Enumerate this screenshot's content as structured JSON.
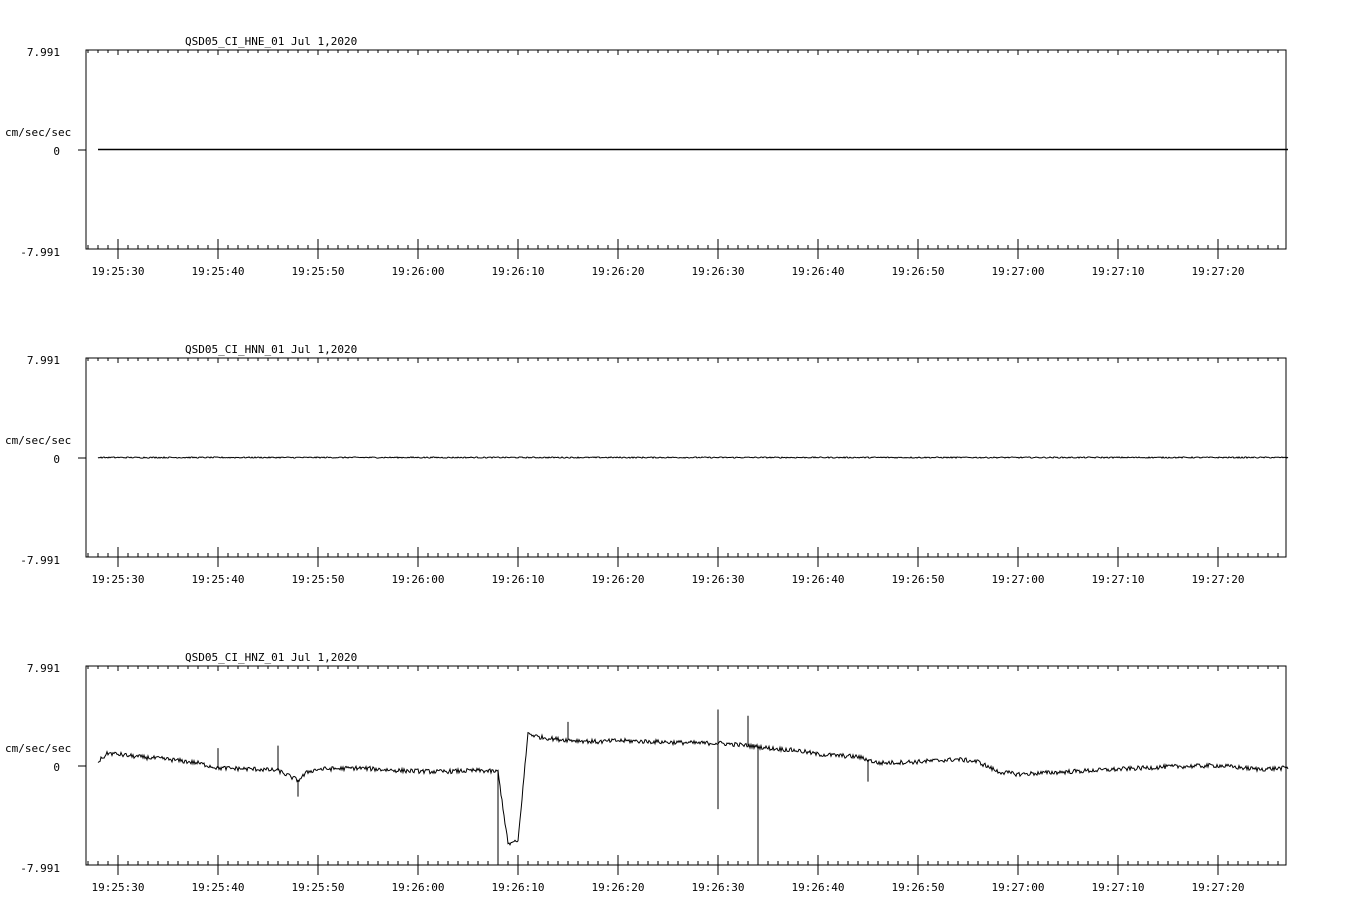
{
  "chart_data": [
    {
      "type": "line",
      "title": "QSD05_CI_HNE_01  Jul 1,2020",
      "ylabel": "cm/sec/sec",
      "ylim": [
        -7.991,
        7.991
      ],
      "yticks": [
        "7.991",
        "0",
        "-7.991"
      ],
      "x_start": "19:25:28",
      "x_end": "19:27:27",
      "xlim_seconds": [
        -1.2,
        118.8
      ],
      "xticks": [
        "19:25:30",
        "19:25:40",
        "19:25:50",
        "19:26:00",
        "19:26:10",
        "19:26:20",
        "19:26:30",
        "19:26:40",
        "19:26:50",
        "19:27:00",
        "19:27:10",
        "19:27:20"
      ],
      "series": [
        {
          "x": [
            "19:25:28",
            "19:27:27"
          ],
          "y": [
            0,
            0
          ]
        }
      ]
    },
    {
      "type": "line",
      "title": "QSD05_CI_HNN_01  Jul 1,2020",
      "ylabel": "cm/sec/sec",
      "ylim": [
        -7.991,
        7.991
      ],
      "yticks": [
        "7.991",
        "0",
        "-7.991"
      ],
      "x_start": "19:25:28",
      "x_end": "19:27:27",
      "xlim_seconds": [
        -1.2,
        118.8
      ],
      "xticks": [
        "19:25:30",
        "19:25:40",
        "19:25:50",
        "19:26:00",
        "19:26:10",
        "19:26:20",
        "19:26:30",
        "19:26:40",
        "19:26:50",
        "19:27:00",
        "19:27:10",
        "19:27:20"
      ],
      "series": [
        {
          "x": [
            "19:25:28",
            "19:27:27"
          ],
          "y": [
            0,
            0
          ],
          "noise": 0.05
        }
      ]
    },
    {
      "type": "line",
      "title": "QSD05_CI_HNZ_01  Jul 1,2020",
      "ylabel": "cm/sec/sec",
      "ylim": [
        -7.991,
        7.991
      ],
      "yticks": [
        "7.991",
        "0",
        "-7.991"
      ],
      "x_start": "19:25:28",
      "x_end": "19:27:27",
      "xlim_seconds": [
        -1.2,
        118.8
      ],
      "xticks": [
        "19:25:30",
        "19:25:40",
        "19:25:50",
        "19:26:00",
        "19:26:10",
        "19:26:20",
        "19:26:30",
        "19:26:40",
        "19:26:50",
        "19:27:00",
        "19:27:10",
        "19:27:20"
      ],
      "series": [
        {
          "x": [
            "19:25:28",
            "19:25:29",
            "19:25:32",
            "19:25:35",
            "19:25:38",
            "19:25:40",
            "19:25:44",
            "19:25:46",
            "19:25:47",
            "19:25:48",
            "19:25:49",
            "19:25:50",
            "19:25:54",
            "19:25:58",
            "19:26:02",
            "19:26:06",
            "19:26:08",
            "19:26:09",
            "19:26:10",
            "19:26:11",
            "19:26:12",
            "19:26:14",
            "19:26:16",
            "19:26:18",
            "19:26:20",
            "19:26:24",
            "19:26:28",
            "19:26:30",
            "19:26:33",
            "19:26:34",
            "19:26:35",
            "19:26:38",
            "19:26:40",
            "19:26:44",
            "19:26:46",
            "19:26:50",
            "19:26:54",
            "19:26:56",
            "19:26:58",
            "19:27:00",
            "19:27:05",
            "19:27:10",
            "19:27:15",
            "19:27:20",
            "19:27:24",
            "19:27:27"
          ],
          "y": [
            0.3,
            1.0,
            0.7,
            0.5,
            0.2,
            -0.2,
            -0.3,
            -0.4,
            -0.8,
            -1.2,
            -0.5,
            -0.3,
            -0.2,
            -0.4,
            -0.5,
            -0.4,
            -0.5,
            -6.3,
            -6.1,
            2.6,
            2.3,
            2.1,
            2.0,
            1.9,
            2.0,
            1.9,
            1.8,
            1.8,
            1.6,
            1.5,
            1.4,
            1.2,
            0.9,
            0.7,
            0.2,
            0.3,
            0.5,
            0.3,
            -0.5,
            -0.7,
            -0.5,
            -0.3,
            -0.1,
            0.0,
            -0.3,
            -0.2
          ],
          "spikes": [
            {
              "x": "19:25:40",
              "y": 1.4
            },
            {
              "x": "19:25:46",
              "y": 1.6
            },
            {
              "x": "19:25:48",
              "y": -2.5
            },
            {
              "x": "19:26:08",
              "y": -9.0
            },
            {
              "x": "19:26:15",
              "y": 3.5
            },
            {
              "x": "19:26:30",
              "y": 4.5
            },
            {
              "x": "19:26:30",
              "y": -3.5
            },
            {
              "x": "19:26:33",
              "y": 4.0
            },
            {
              "x": "19:26:34",
              "y": -9.5
            },
            {
              "x": "19:26:45",
              "y": -1.3
            }
          ]
        }
      ]
    }
  ]
}
